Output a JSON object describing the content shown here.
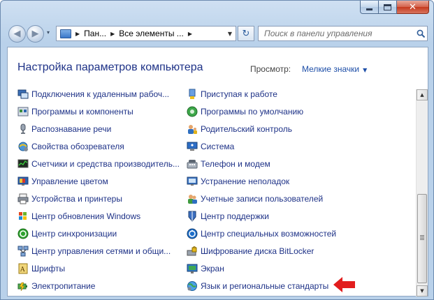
{
  "window": {
    "close_glyph": "✕",
    "accent": "#1e3287",
    "link_color": "#1e4fa8",
    "highlight_arrow_color": "#e21d1d"
  },
  "nav": {
    "back_glyph": "◀",
    "forward_glyph": "▶",
    "history_glyph": "▾",
    "refresh_glyph": "↻",
    "address_crumbs": [
      "Пан...",
      "Все элементы ..."
    ],
    "search_placeholder": "Поиск в панели управления"
  },
  "main": {
    "title": "Настройка параметров компьютера",
    "view_label": "Просмотр:",
    "view_value": "Мелкие значки"
  },
  "left_items": [
    {
      "label": "Подключения к удаленным рабоч...",
      "icon": "remote-connection-icon"
    },
    {
      "label": "Программы и компоненты",
      "icon": "programs-icon"
    },
    {
      "label": "Распознавание речи",
      "icon": "microphone-icon"
    },
    {
      "label": "Свойства обозревателя",
      "icon": "internet-options-icon"
    },
    {
      "label": "Счетчики и средства производитель...",
      "icon": "performance-icon"
    },
    {
      "label": "Управление цветом",
      "icon": "color-management-icon"
    },
    {
      "label": "Устройства и принтеры",
      "icon": "printer-icon"
    },
    {
      "label": "Центр обновления Windows",
      "icon": "windows-update-icon"
    },
    {
      "label": "Центр синхронизации",
      "icon": "sync-icon"
    },
    {
      "label": "Центр управления сетями и общи...",
      "icon": "network-icon"
    },
    {
      "label": "Шрифты",
      "icon": "fonts-icon"
    },
    {
      "label": "Электропитание",
      "icon": "power-icon"
    }
  ],
  "right_items": [
    {
      "label": "Приступая к работе",
      "icon": "getting-started-icon"
    },
    {
      "label": "Программы по умолчанию",
      "icon": "default-programs-icon"
    },
    {
      "label": "Родительский контроль",
      "icon": "parental-controls-icon"
    },
    {
      "label": "Система",
      "icon": "system-icon"
    },
    {
      "label": "Телефон и модем",
      "icon": "phone-modem-icon"
    },
    {
      "label": "Устранение неполадок",
      "icon": "troubleshooting-icon"
    },
    {
      "label": "Учетные записи пользователей",
      "icon": "user-accounts-icon"
    },
    {
      "label": "Центр поддержки",
      "icon": "action-center-icon"
    },
    {
      "label": "Центр специальных возможностей",
      "icon": "ease-of-access-icon"
    },
    {
      "label": "Шифрование диска BitLocker",
      "icon": "bitlocker-icon"
    },
    {
      "label": "Экран",
      "icon": "display-icon"
    },
    {
      "label": "Язык и региональные стандарты",
      "icon": "region-language-icon"
    }
  ]
}
